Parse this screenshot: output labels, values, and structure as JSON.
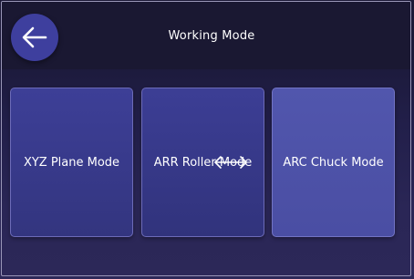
{
  "header": {
    "title": "Working Mode",
    "back_icon": "arrow-left-icon"
  },
  "modes": [
    {
      "label": "XYZ Plane Mode"
    },
    {
      "label": "ARR Roller Mode"
    },
    {
      "label": "ARC Chuck Mode"
    }
  ],
  "overlay": {
    "icon": "horizontal-double-arrow-icon"
  },
  "colors": {
    "background": "#1c1a3b",
    "header": "#1a1832",
    "back_button": "#3e3f9e",
    "card": "#3a3c92",
    "card_selected": "#4f53aa",
    "text": "#ffffff"
  }
}
